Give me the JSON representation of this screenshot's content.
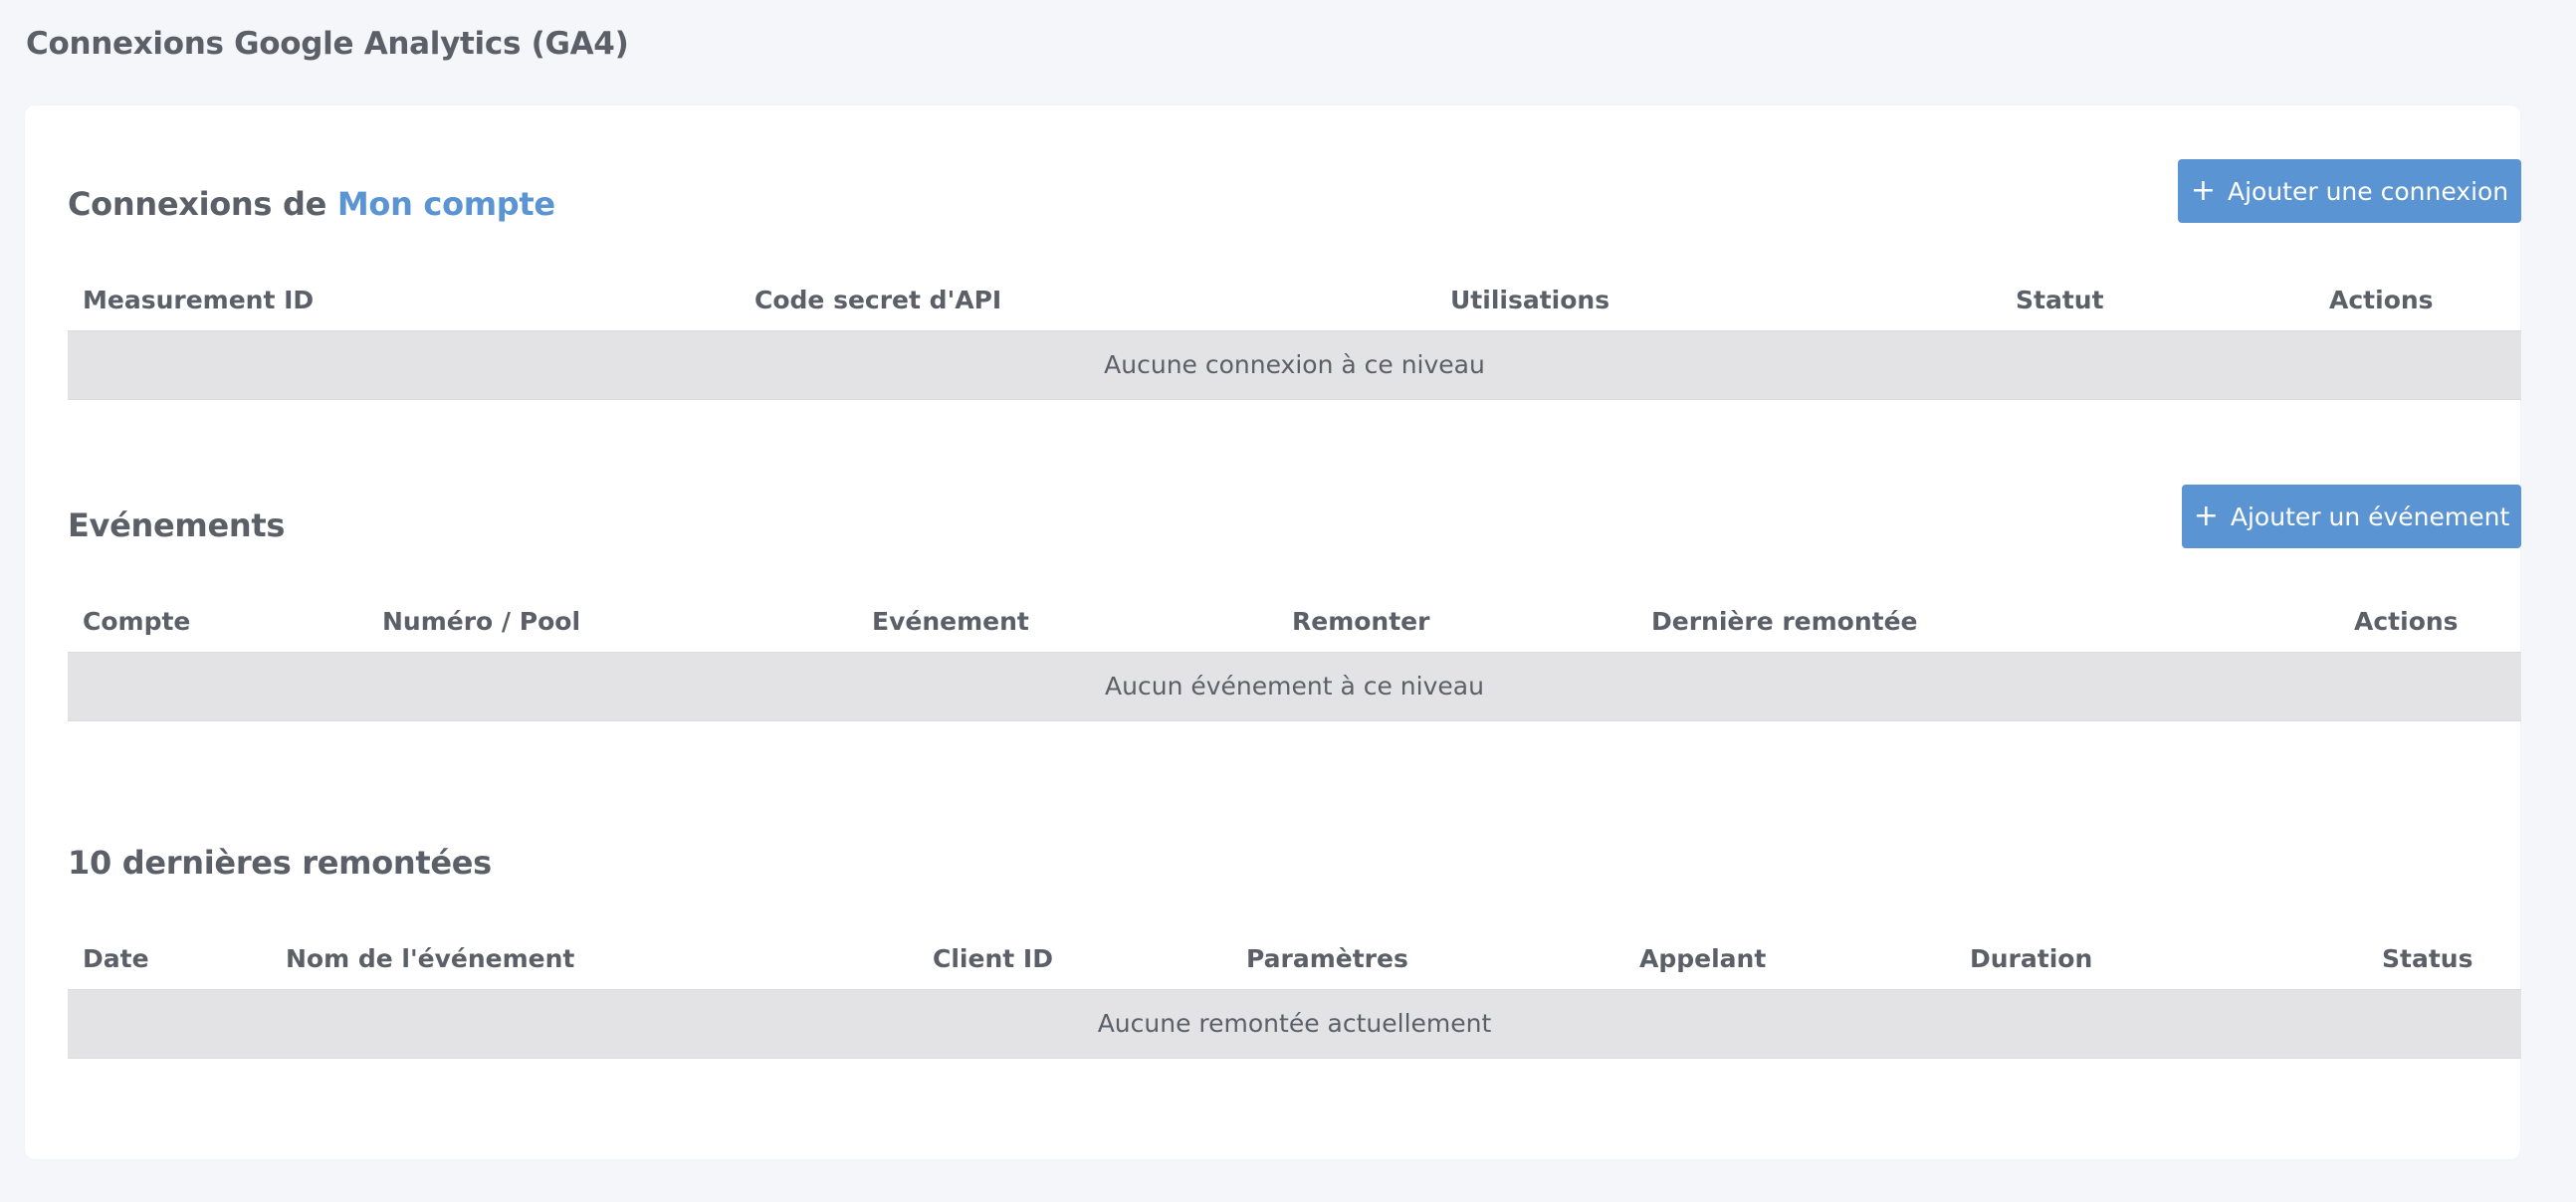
{
  "page": {
    "title": "Connexions Google Analytics (GA4)"
  },
  "connections": {
    "title_prefix": "Connexions de ",
    "title_account": "Mon compte",
    "add_button": "Ajouter une connexion",
    "columns": [
      "Measurement ID",
      "Code secret d'API",
      "Utilisations",
      "Statut",
      "Actions"
    ],
    "empty": "Aucune connexion à ce niveau"
  },
  "events": {
    "title": "Evénements",
    "add_button": "Ajouter un événement",
    "columns": [
      "Compte",
      "Numéro / Pool",
      "Evénement",
      "Remonter",
      "Dernière remontée",
      "Actions"
    ],
    "empty": "Aucun événement à ce niveau"
  },
  "uploads": {
    "title": "10 dernières remontées",
    "columns": [
      "Date",
      "Nom de l'événement",
      "Client ID",
      "Paramètres",
      "Appelant",
      "Duration",
      "Status"
    ],
    "empty": "Aucune remontée actuellement"
  },
  "colors": {
    "accent": "#5a94d2",
    "background": "#f5f6f9",
    "card": "#ffffff",
    "empty_row": "#e3e3e5",
    "text": "#5b6068"
  },
  "icons": {
    "add": "plus-icon"
  }
}
